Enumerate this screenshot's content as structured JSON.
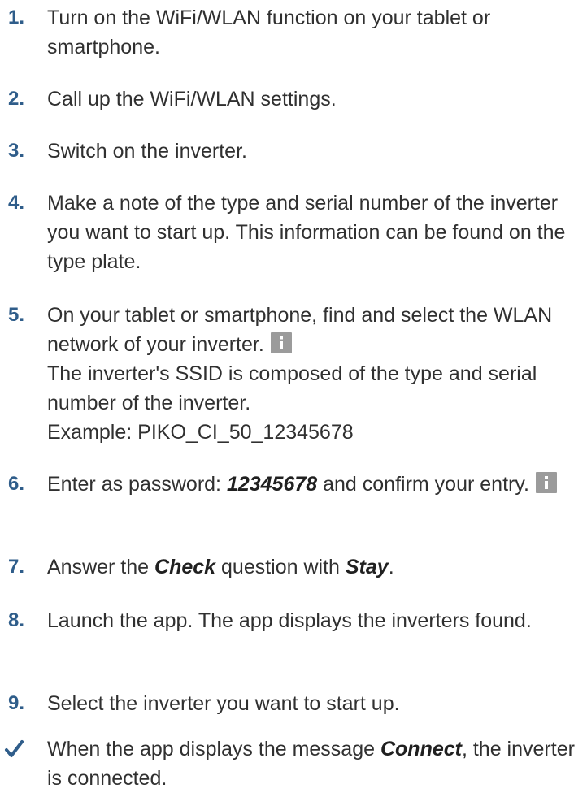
{
  "steps": [
    {
      "num": "1.",
      "lines": [
        "Turn on the WiFi/WLAN function on your tablet or smartphone."
      ]
    },
    {
      "num": "2.",
      "lines": [
        "Call up the WiFi/WLAN settings."
      ]
    },
    {
      "num": "3.",
      "lines": [
        "Switch on the inverter."
      ]
    },
    {
      "num": "4.",
      "lines": [
        "Make a note of the type and serial number of the inverter you want to start up. This information can be found on the type plate."
      ]
    },
    {
      "num": "5.",
      "main": "On your tablet or smartphone, find and select the WLAN network of your inverter.",
      "info_icon": "info-icon",
      "detail": "The inverter's SSID is composed of the type and serial number of the inverter.",
      "example": "Example: PIKO_CI_50_12345678"
    },
    {
      "num": "6.",
      "prefix": "Enter as password: ",
      "password": "12345678",
      "suffix": " and confirm your entry.",
      "info_icon": "info-icon"
    },
    {
      "num": "7.",
      "prefix": "Answer the ",
      "bold1": "Check",
      "middle": " question with ",
      "bold2": "Stay",
      "suffix": "."
    },
    {
      "num": "8.",
      "lines": [
        "Launch the app. The app displays the inverters found."
      ]
    },
    {
      "num": "9.",
      "lines": [
        "Select the inverter you want to start up."
      ]
    }
  ],
  "result": {
    "icon": "checkmark-icon",
    "prefix": "When the app displays the message ",
    "bold": "Connect",
    "suffix": ", the inverter is connected."
  },
  "colors": {
    "step_number": "#2f5d8a",
    "text": "#303030",
    "info_icon_bg": "#9b9b9b"
  }
}
